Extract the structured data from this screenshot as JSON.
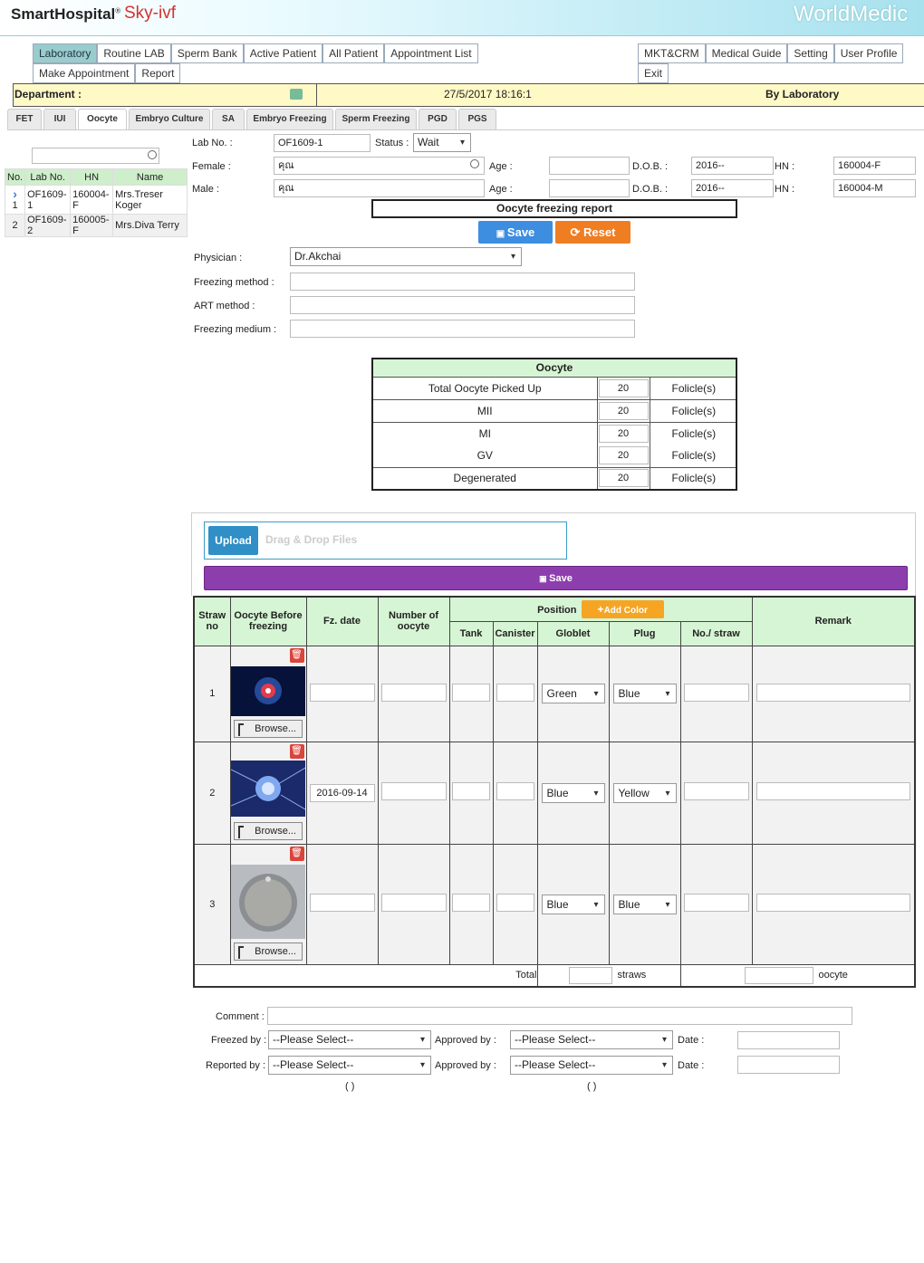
{
  "header": {
    "brand_left": "SmartHospital",
    "brand_reg": "®",
    "brand_sub": "Sky-ivf",
    "brand_right": "WorldMedic"
  },
  "nav_left_row1": [
    "Laboratory",
    "Routine LAB",
    "Sperm Bank",
    "Active Patient",
    "All Patient",
    "Appointment List"
  ],
  "nav_left_row2": [
    "Make Appointment",
    "Report"
  ],
  "nav_right_row1": [
    "MKT&CRM",
    "Medical Guide",
    "Setting",
    "User Profile"
  ],
  "nav_right_row2": [
    "Exit"
  ],
  "dept": {
    "label": "Department :",
    "datetime": "27/5/2017 18:16:1",
    "by": "By Laboratory"
  },
  "tabs": [
    "FET",
    "IUI",
    "Oocyte",
    "Embryo Culture",
    "SA",
    "Embryo Freezing",
    "Sperm Freezing",
    "PGD",
    "PGS"
  ],
  "left_list": {
    "headers": [
      "No.",
      "Lab No.",
      "HN",
      "Name"
    ],
    "rows": [
      {
        "no": "1",
        "lab": "OF1609-1",
        "hn": "160004-F",
        "name": "Mrs.Treser Koger"
      },
      {
        "no": "2",
        "lab": "OF1609-2",
        "hn": "160005-F",
        "name": "Mrs.Diva Terry"
      }
    ]
  },
  "form": {
    "labno_label": "Lab No. :",
    "labno": "OF1609-1",
    "status_label": "Status :",
    "status": "Wait",
    "female_label": "Female :",
    "female_name": "คุณ",
    "male_label": "Male :",
    "male_name": "คุณ",
    "age_label": "Age :",
    "dob_label": "D.O.B. :",
    "hn_label": "HN :",
    "female_dob": "2016--",
    "female_hn": "160004-F",
    "male_dob": "2016--",
    "male_hn": "160004-M",
    "report_title": "Oocyte freezing report",
    "save": "Save",
    "reset": "Reset",
    "physician_label": "Physician :",
    "physician": "Dr.Akchai",
    "freezing_method_label": "Freezing method :",
    "art_method_label": "ART method :",
    "freezing_medium_label": "Freezing medium :"
  },
  "oocyte_table": {
    "title": "Oocyte",
    "unit": "Folicle(s)",
    "rows": [
      {
        "label": "Total Oocyte Picked Up",
        "value": "20"
      },
      {
        "label": "MII",
        "value": "20"
      },
      {
        "label": "MI",
        "value": "20"
      },
      {
        "label": "GV",
        "value": "20"
      },
      {
        "label": "Degenerated",
        "value": "20"
      }
    ]
  },
  "upload": {
    "button": "Upload",
    "hint": "Drag & Drop Files",
    "save": "Save"
  },
  "straw_table": {
    "headers": {
      "straw_no": "Straw no",
      "oocyte": "Oocyte Before freezing",
      "fz_date": "Fz. date",
      "num_oocyte": "Number of oocyte",
      "position": "Position",
      "add_color": "Add Color",
      "tank": "Tank",
      "canister": "Canister",
      "goblet": "Globlet",
      "plug": "Plug",
      "no_straw": "No./ straw",
      "remark": "Remark"
    },
    "browse": "Browse...",
    "rows": [
      {
        "no": "1",
        "fz_date": "",
        "goblet": "Green",
        "plug": "Blue"
      },
      {
        "no": "2",
        "fz_date": "2016-09-14",
        "goblet": "Blue",
        "plug": "Yellow"
      },
      {
        "no": "3",
        "fz_date": "",
        "goblet": "Blue",
        "plug": "Blue"
      }
    ],
    "total_label": "Total",
    "straws": "straws",
    "oocyte": "oocyte"
  },
  "footer": {
    "comment_label": "Comment :",
    "freezed_by_label": "Freezed by :",
    "reported_by_label": "Reported by :",
    "approved_by_label": "Approved by :",
    "date_label": "Date :",
    "please_select": "--Please Select--",
    "paren": "( )"
  },
  "colors": {
    "save": "#3d8de0",
    "reset": "#ef7d22",
    "purple": "#8d3ead",
    "upload": "#2f8fc6",
    "dept": "#fff9c6",
    "green_header": "#d6f5d4"
  }
}
